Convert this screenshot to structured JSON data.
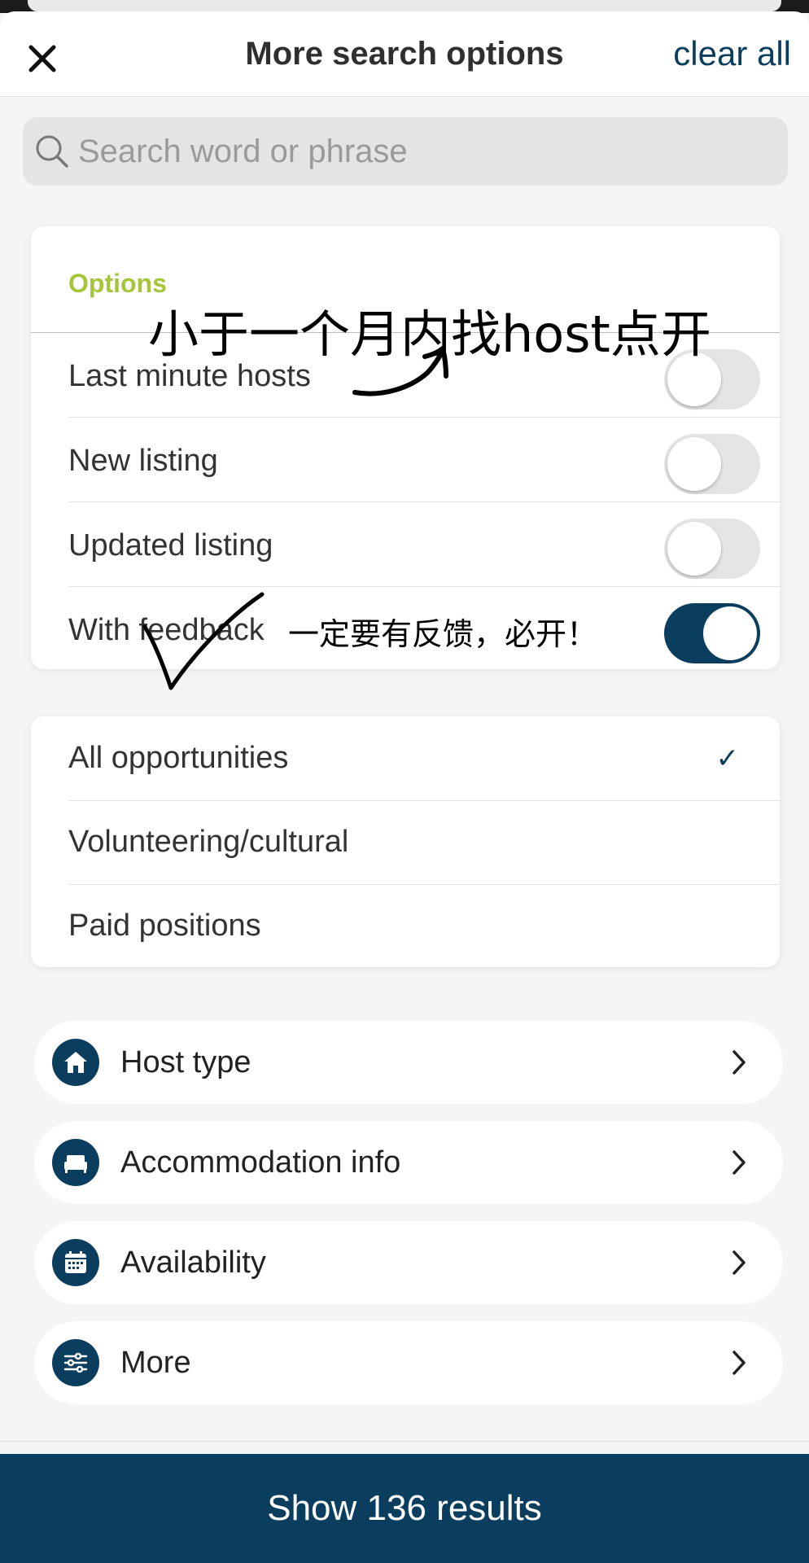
{
  "header": {
    "title": "More search options",
    "clear_all": "clear all"
  },
  "search": {
    "placeholder": "Search word or phrase"
  },
  "options": {
    "label": "Options",
    "items": [
      {
        "label": "Last minute hosts",
        "on": false
      },
      {
        "label": "New listing",
        "on": false
      },
      {
        "label": "Updated listing",
        "on": false
      },
      {
        "label": "With feedback",
        "on": true
      }
    ]
  },
  "opportunities": {
    "items": [
      {
        "label": "All opportunities",
        "selected": true
      },
      {
        "label": "Volunteering/cultural",
        "selected": false
      },
      {
        "label": "Paid positions",
        "selected": false
      }
    ]
  },
  "filters": [
    {
      "label": "Host type",
      "icon": "home-icon"
    },
    {
      "label": "Accommodation info",
      "icon": "bed-icon"
    },
    {
      "label": "Availability",
      "icon": "calendar-icon"
    },
    {
      "label": "More",
      "icon": "sliders-icon"
    }
  ],
  "show_button": "Show 136 results",
  "annotations": {
    "note_last_minute": "小于一个月内找host点开",
    "note_feedback": "一定要有反馈，必开！"
  },
  "colors": {
    "accent": "#0b3d5e",
    "options_label": "#a6c63a"
  }
}
